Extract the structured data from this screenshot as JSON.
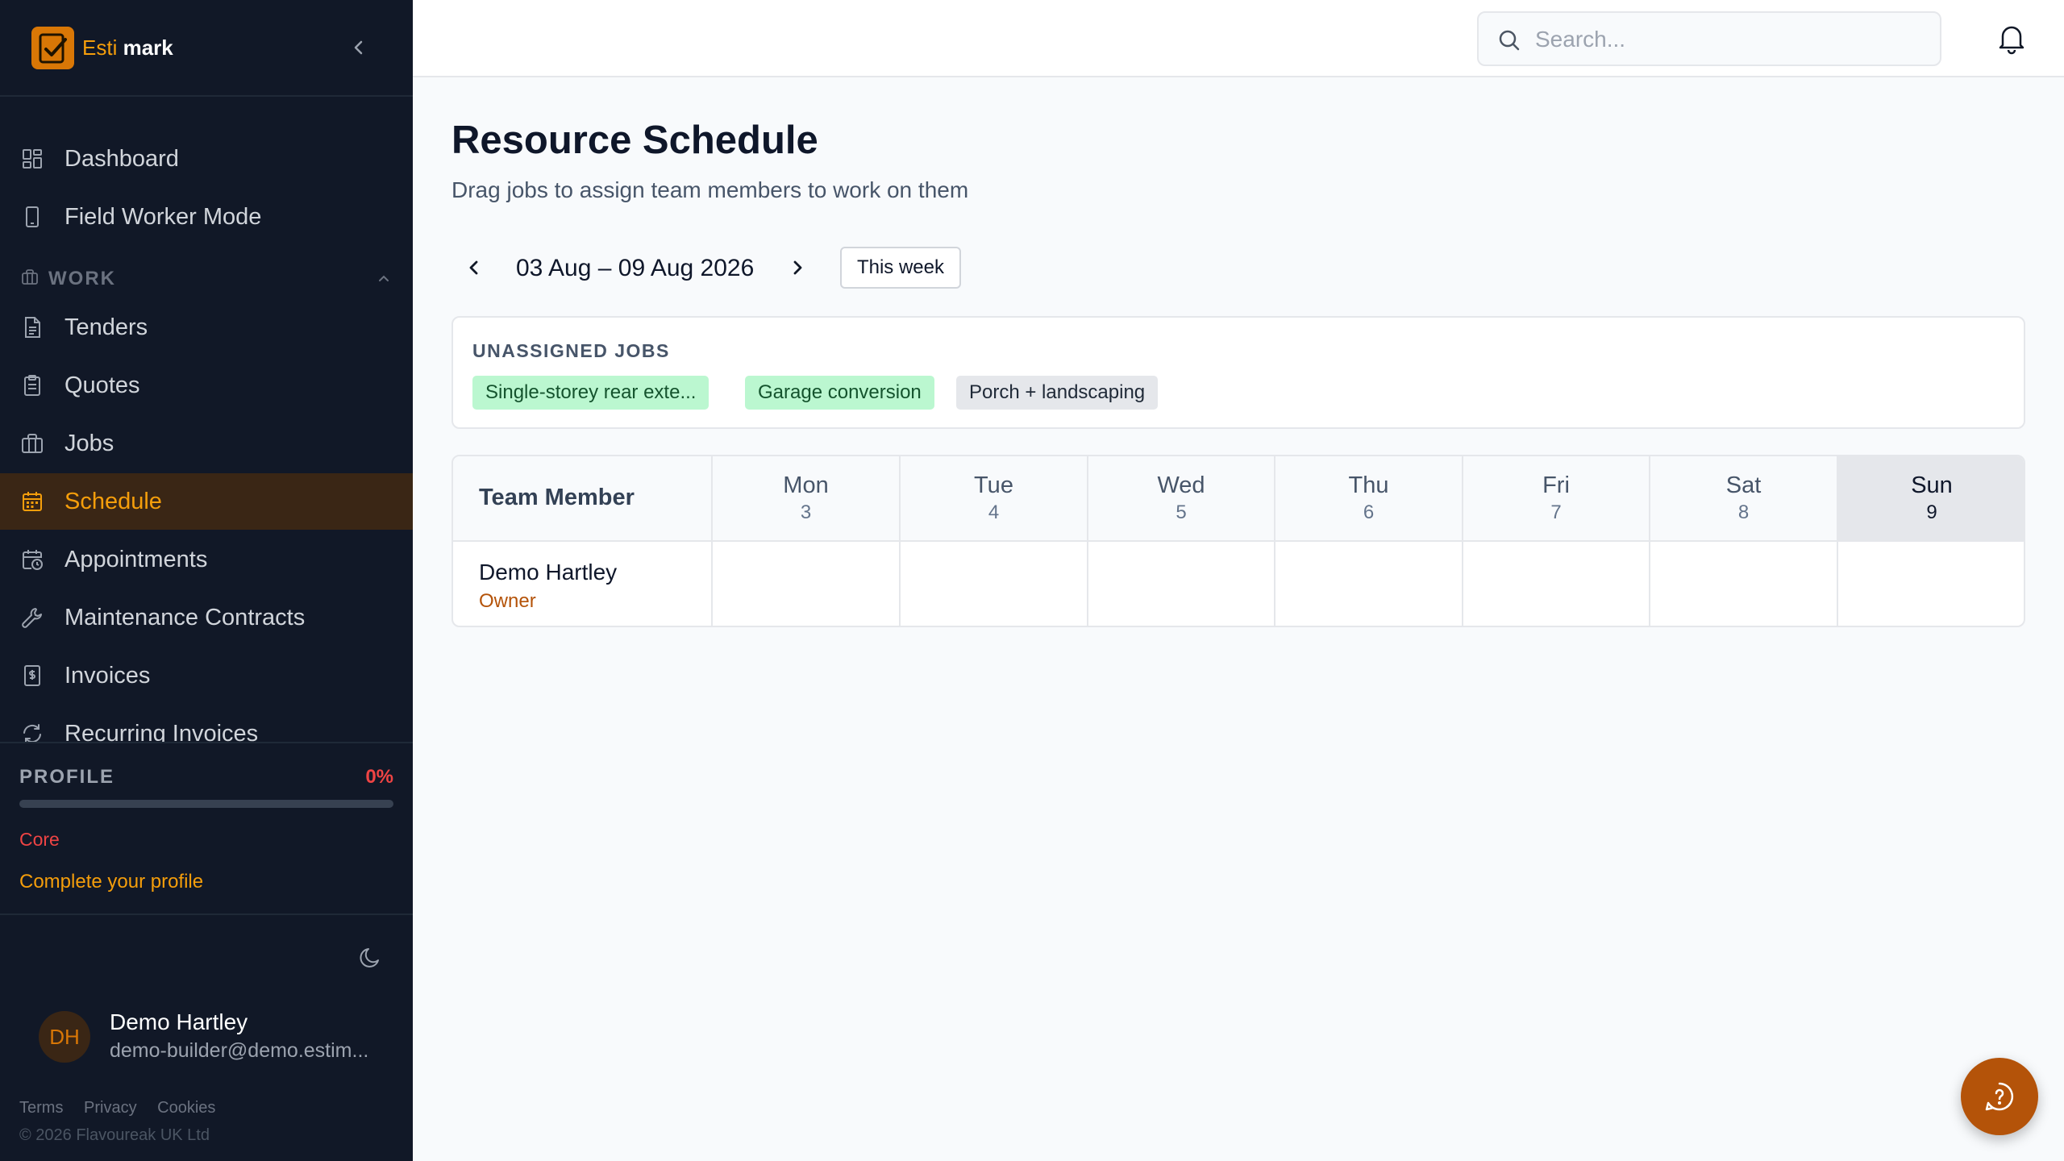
{
  "app": {
    "brand_part1": "Esti",
    "brand_part2": "mark",
    "accent_color": "#d97706"
  },
  "sidebar": {
    "items_top": [
      {
        "label": "Dashboard",
        "icon": "grid-icon"
      },
      {
        "label": "Field Worker Mode",
        "icon": "phone-icon"
      }
    ],
    "section": {
      "label": "WORK",
      "icon": "briefcase-icon"
    },
    "items_work": [
      {
        "label": "Tenders",
        "icon": "document-icon"
      },
      {
        "label": "Quotes",
        "icon": "clipboard-icon"
      },
      {
        "label": "Jobs",
        "icon": "briefcase-icon"
      },
      {
        "label": "Schedule",
        "icon": "calendar-icon",
        "active": true
      },
      {
        "label": "Appointments",
        "icon": "calendar-clock-icon"
      },
      {
        "label": "Maintenance Contracts",
        "icon": "wrench-icon"
      },
      {
        "label": "Invoices",
        "icon": "receipt-icon"
      },
      {
        "label": "Recurring Invoices",
        "icon": "refresh-icon"
      }
    ]
  },
  "profile": {
    "title": "PROFILE",
    "percent_label": "0%",
    "progress": 0,
    "core_label": "Core",
    "complete_link": "Complete your profile"
  },
  "user": {
    "initials": "DH",
    "name": "Demo Hartley",
    "email": "demo-builder@demo.estim..."
  },
  "footer": {
    "terms": "Terms",
    "privacy": "Privacy",
    "cookies": "Cookies",
    "copyright": "© 2026 Flavoureak UK Ltd"
  },
  "topbar": {
    "search_placeholder": "Search..."
  },
  "main": {
    "title": "Resource Schedule",
    "subtitle": "Drag jobs to assign team members to work on them",
    "week_range": "03 Aug – 09 Aug 2026",
    "this_week_label": "This week",
    "unassigned": {
      "title": "UNASSIGNED JOBS",
      "jobs": [
        {
          "label": "Single-storey rear exte...",
          "status": "green"
        },
        {
          "label": "Garage conversion",
          "status": "green"
        },
        {
          "label": "Porch + landscaping",
          "status": "gray"
        }
      ]
    },
    "schedule": {
      "member_header": "Team Member",
      "days": [
        {
          "day": "Mon",
          "date": "3"
        },
        {
          "day": "Tue",
          "date": "4"
        },
        {
          "day": "Wed",
          "date": "5"
        },
        {
          "day": "Thu",
          "date": "6"
        },
        {
          "day": "Fri",
          "date": "7"
        },
        {
          "day": "Sat",
          "date": "8"
        },
        {
          "day": "Sun",
          "date": "9",
          "today": true
        }
      ],
      "members": [
        {
          "name": "Demo Hartley",
          "role": "Owner"
        }
      ]
    }
  }
}
